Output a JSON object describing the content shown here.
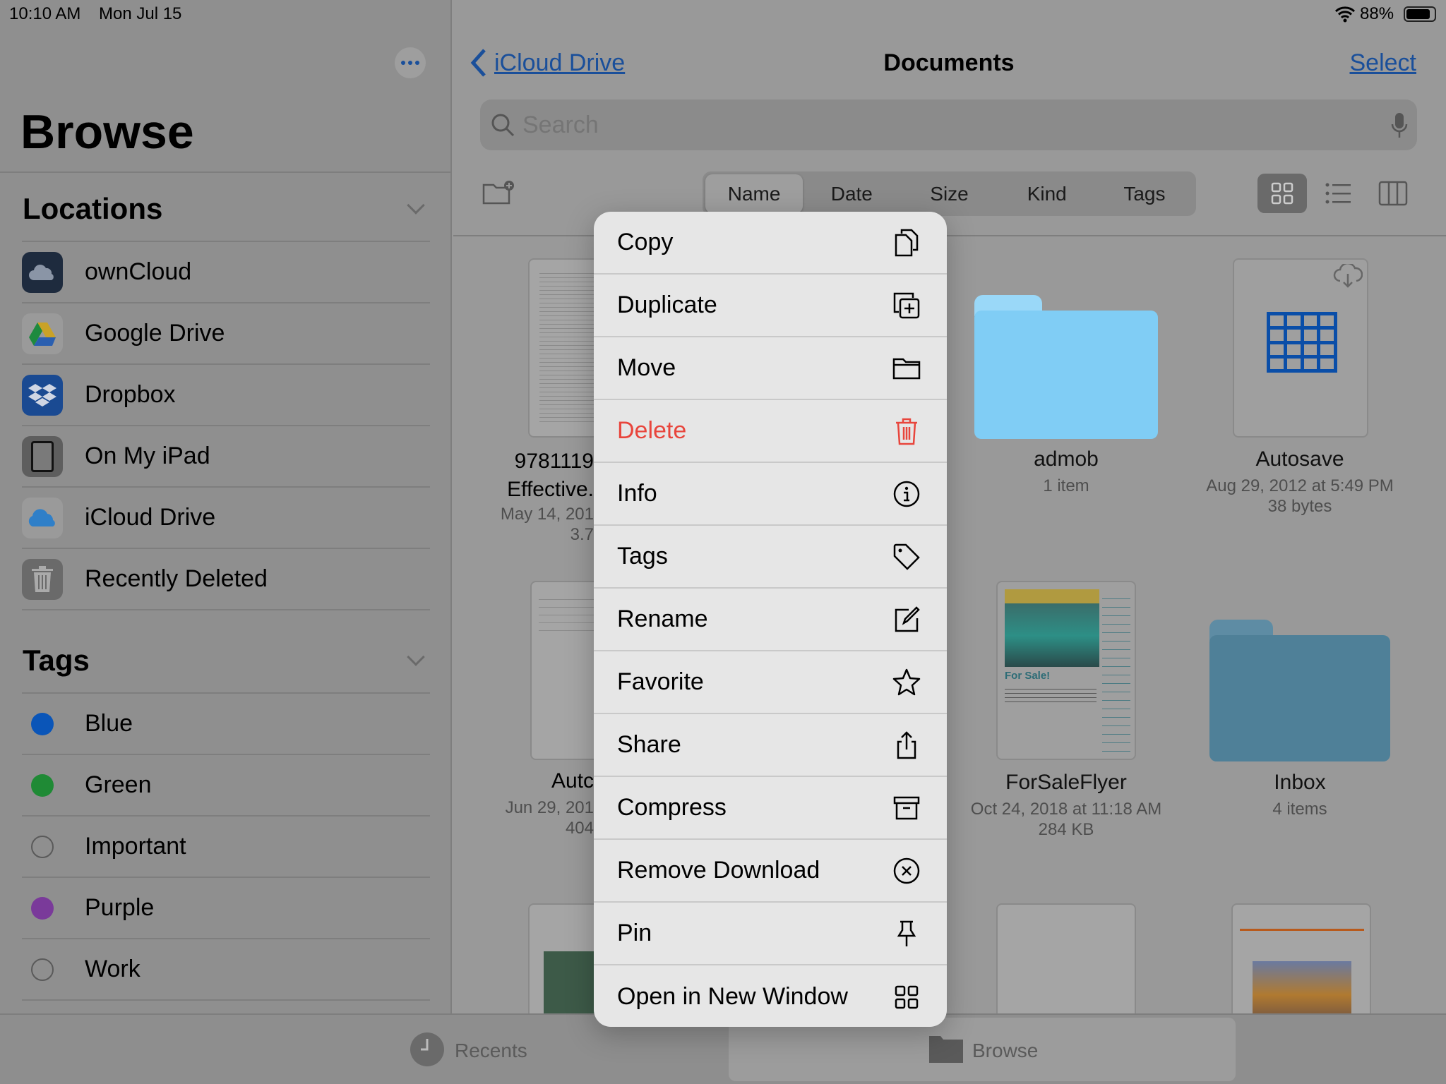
{
  "status": {
    "time": "10:10 AM",
    "date": "Mon Jul 15",
    "battery": "88%",
    "battery_level": 0.88
  },
  "sidebar": {
    "title": "Browse",
    "more_icon": "ellipsis-icon",
    "locations_header": "Locations",
    "locations": [
      {
        "label": "ownCloud",
        "icon": "owncloud-icon"
      },
      {
        "label": "Google Drive",
        "icon": "google-drive-icon"
      },
      {
        "label": "Dropbox",
        "icon": "dropbox-icon"
      },
      {
        "label": "On My iPad",
        "icon": "ipad-icon"
      },
      {
        "label": "iCloud Drive",
        "icon": "icloud-icon"
      },
      {
        "label": "Recently Deleted",
        "icon": "trash-icon"
      }
    ],
    "tags_header": "Tags",
    "tags": [
      {
        "label": "Blue",
        "color": "#0a55b8"
      },
      {
        "label": "Green",
        "color": "#1f8a35"
      },
      {
        "label": "Important",
        "color": ""
      },
      {
        "label": "Purple",
        "color": "#7a3a9a"
      },
      {
        "label": "Work",
        "color": ""
      }
    ]
  },
  "nav": {
    "back": "iCloud Drive",
    "title": "Documents",
    "select": "Select"
  },
  "search": {
    "placeholder": "Search"
  },
  "sort": {
    "tabs": [
      "Name",
      "Date",
      "Size",
      "Kind",
      "Tags"
    ],
    "selected": "Name"
  },
  "view": {
    "selected": "grid"
  },
  "files": [
    {
      "name1": "9781119",
      "name2": "Effective.",
      "sub1": "May 14, 201",
      "sub2": "3.7"
    },
    {
      "name": "admob",
      "sub1": "1 item"
    },
    {
      "name": "Autosave",
      "sub1": "Aug 29, 2012 at 5:49 PM",
      "sub2": "38 bytes"
    },
    {
      "name1": "Autc",
      "sub1": "Jun 29, 201",
      "sub2": "404"
    },
    {
      "name": "ForSaleFlyer",
      "sub1": "Oct 24, 2018 at 11:18 AM",
      "sub2": "284 KB",
      "thumb_text": "For Sale!"
    },
    {
      "name": "Inbox",
      "sub1": "4 items"
    }
  ],
  "menu": [
    {
      "label": "Copy",
      "icon": "copy-icon"
    },
    {
      "label": "Duplicate",
      "icon": "duplicate-icon"
    },
    {
      "label": "Move",
      "icon": "folder-icon"
    },
    {
      "label": "Delete",
      "icon": "trash-icon",
      "color": "#e8453c"
    },
    {
      "label": "Info",
      "icon": "info-icon"
    },
    {
      "label": "Tags",
      "icon": "tag-icon"
    },
    {
      "label": "Rename",
      "icon": "pencil-square-icon"
    },
    {
      "label": "Favorite",
      "icon": "star-icon"
    },
    {
      "label": "Share",
      "icon": "share-icon"
    },
    {
      "label": "Compress",
      "icon": "archive-box-icon"
    },
    {
      "label": "Remove Download",
      "icon": "x-circle-icon"
    },
    {
      "label": "Pin",
      "icon": "pin-icon"
    },
    {
      "label": "Open in New Window",
      "icon": "grid-window-icon"
    }
  ],
  "tabbar": {
    "recents": "Recents",
    "browse": "Browse",
    "selected": "Browse"
  }
}
